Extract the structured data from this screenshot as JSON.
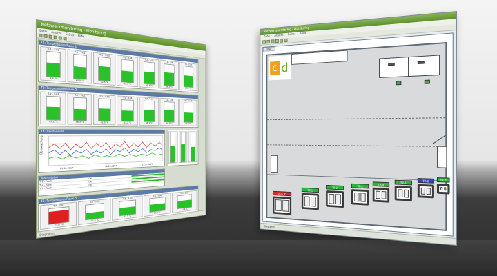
{
  "left_window": {
    "title": "Netzwerkmonitoring - Monitoring",
    "menu": [
      "Datei",
      "Ansicht",
      "Extras",
      "Hilfe"
    ],
    "row1_header": "T1: Temperaturen Raum 1",
    "row1_tiles": [
      {
        "label": "T-1 - T-01",
        "value": "3.8 °C",
        "level": 0.55
      },
      {
        "label": "T-1 - T-02",
        "value": "23.0 °C",
        "level": 0.5
      },
      {
        "label": "T-1 - T-03",
        "value": "42.5 °C",
        "level": 0.6
      },
      {
        "label": "T-1 - T-04",
        "value": "23.2 °C",
        "level": 0.5
      },
      {
        "label": "T-1 - T-05",
        "value": "40.3 °C",
        "level": 0.55
      },
      {
        "label": "T-1 - T-06",
        "value": "36.3 °C",
        "level": 0.6
      },
      {
        "label": "T-1 - T-07",
        "value": "23.2 °C",
        "level": 0.55
      }
    ],
    "row2_header": "T2: Temperaturen Raum 2",
    "row2_tiles": [
      {
        "label": "T-2 - T-01",
        "value": "45.1 °C",
        "level": 0.55
      },
      {
        "label": "T-2 - T-02",
        "value": "46.3 °C",
        "level": 0.5
      },
      {
        "label": "T-2 - T-03",
        "value": "42.0 °C",
        "level": 0.55
      },
      {
        "label": "T-2 - T-04",
        "value": "23.2 °C",
        "level": 0.5
      },
      {
        "label": "T-2 - T-05",
        "value": "36.3 °C",
        "level": 0.55
      },
      {
        "label": "T-2 - T-06",
        "value": "40.3 °C",
        "level": 0.6
      },
      {
        "label": "T-2 - T-07",
        "value": "23.2 °C",
        "level": 0.5
      }
    ],
    "chart_header": "T4: Trendansicht",
    "chart_ylabel": "Überwachung",
    "chart_dates": [
      "29.06.2017",
      "30.06.2017",
      "01.07.2017"
    ],
    "table_header": "Alarmstatus",
    "table_rows": [
      {
        "name": "T-1 - Rack",
        "status": "OK"
      },
      {
        "name": "T-2 - Rack",
        "status": "OK"
      },
      {
        "name": "T-3 - Rack",
        "status": "OK"
      }
    ],
    "row3_header": "T5: Temperaturen Raum 5",
    "row3_tiles": [
      {
        "label": "T-5 - T-01",
        "value": "23.6 °C",
        "level": 0.8,
        "alarm": true
      },
      {
        "label": "T-5 - T-02",
        "value": "22.5 °C",
        "level": 0.45
      },
      {
        "label": "T-5 - T-03",
        "value": "23.2 °C",
        "level": 0.55
      },
      {
        "label": "T-5 - T-04",
        "value": "23.2 °C",
        "level": 0.55
      },
      {
        "label": "T-5 - T-05",
        "value": "22.8 °C",
        "level": 0.6
      }
    ],
    "status": "Diagramm"
  },
  "right_window": {
    "title": "Netzwerkmonitoring - Monitoring",
    "menu": [
      "Datei",
      "Ansicht",
      "Extras",
      "Hilfe"
    ],
    "plan_tab": "Plan",
    "logo_letters": [
      "c",
      "d"
    ],
    "rack_tags": [
      {
        "text": "26.6 °C",
        "color": "red"
      },
      {
        "text": "TR-1",
        "color": "green"
      },
      {
        "text": "TR-2",
        "color": "green"
      },
      {
        "text": "TR-3",
        "color": "green"
      },
      {
        "text": "TR-4",
        "color": "green"
      },
      {
        "text": "TR-5",
        "color": "green"
      },
      {
        "text": "TR-6",
        "color": "blue"
      },
      {
        "text": "TR-7",
        "color": "green"
      }
    ],
    "status": "Diagramm"
  }
}
